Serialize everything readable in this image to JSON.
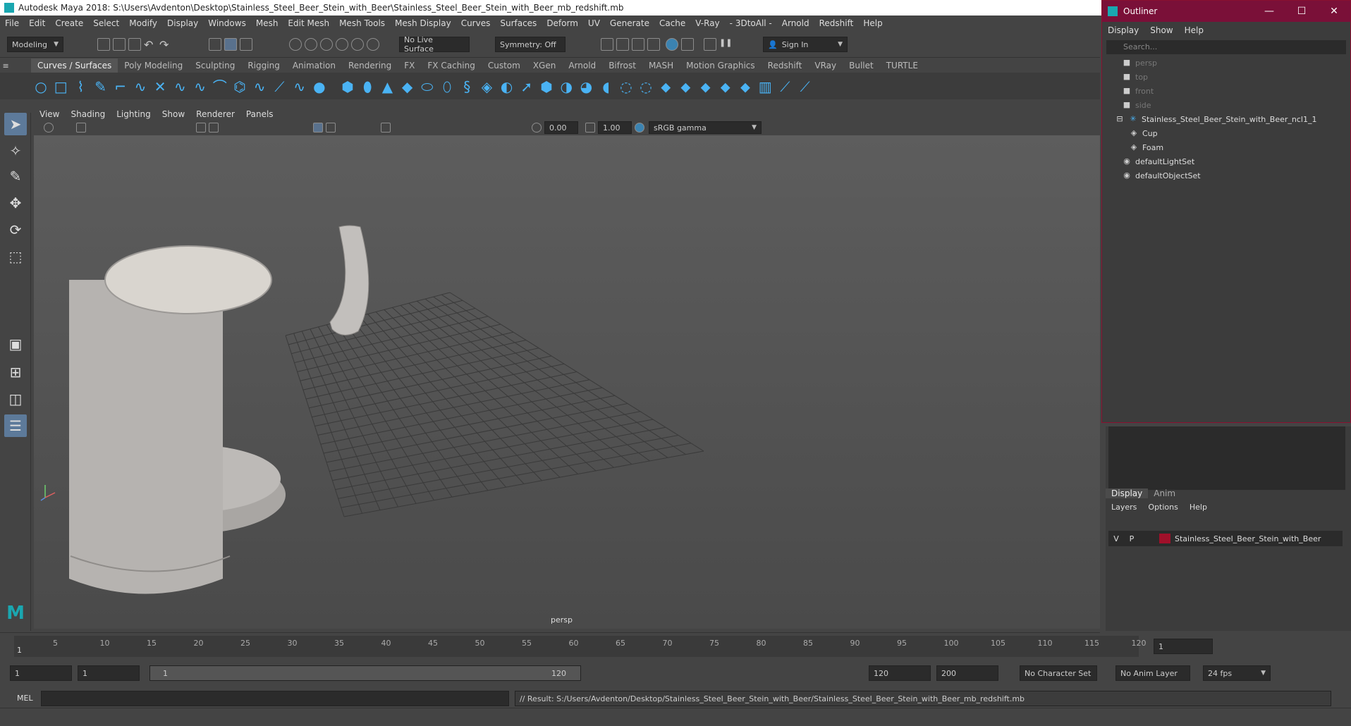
{
  "window": {
    "title": "Autodesk Maya 2018: S:\\Users\\Avdenton\\Desktop\\Stainless_Steel_Beer_Stein_with_Beer\\Stainless_Steel_Beer_Stein_with_Beer_mb_redshift.mb"
  },
  "menubar": [
    "File",
    "Edit",
    "Create",
    "Select",
    "Modify",
    "Display",
    "Windows",
    "Mesh",
    "Edit Mesh",
    "Mesh Tools",
    "Mesh Display",
    "Curves",
    "Surfaces",
    "Deform",
    "UV",
    "Generate",
    "Cache",
    "V-Ray",
    "- 3DtoAll -",
    "Arnold",
    "Redshift",
    "Help"
  ],
  "statusline": {
    "workspace": "Modeling",
    "live_surface": "No Live Surface",
    "symmetry": "Symmetry: Off",
    "sign_in": "Sign In"
  },
  "shelf_tabs": [
    "Curves / Surfaces",
    "Poly Modeling",
    "Sculpting",
    "Rigging",
    "Animation",
    "Rendering",
    "FX",
    "FX Caching",
    "Custom",
    "XGen",
    "Arnold",
    "Bifrost",
    "MASH",
    "Motion Graphics",
    "Redshift",
    "VRay",
    "Bullet",
    "TURTLE"
  ],
  "active_shelf": "Curves / Surfaces",
  "panel_menu": [
    "View",
    "Shading",
    "Lighting",
    "Show",
    "Renderer",
    "Panels"
  ],
  "panel_toolbar": {
    "exposure": "0.00",
    "gamma": "1.00",
    "color_space": "sRGB gamma"
  },
  "viewport": {
    "camera_label": "persp"
  },
  "timeline": {
    "ticks": [
      "5",
      "10",
      "15",
      "20",
      "25",
      "30",
      "35",
      "40",
      "45",
      "50",
      "55",
      "60",
      "65",
      "70",
      "75",
      "80",
      "85",
      "90",
      "95",
      "100",
      "105",
      "110",
      "115",
      "120"
    ],
    "start_marker": "1",
    "current_frame": "1"
  },
  "range": {
    "start": "1",
    "anim_start": "1",
    "slider_start": "1",
    "slider_end": "120",
    "anim_end": "120",
    "end": "200",
    "character_set": "No Character Set",
    "anim_layer": "No Anim Layer",
    "fps": "24 fps"
  },
  "cmdline": {
    "language": "MEL",
    "result": "// Result: S:/Users/Avdenton/Desktop/Stainless_Steel_Beer_Stein_with_Beer/Stainless_Steel_Beer_Stein_with_Beer_mb_redshift.mb"
  },
  "outliner": {
    "title": "Outliner",
    "menu": [
      "Display",
      "Show",
      "Help"
    ],
    "search_placeholder": "Search...",
    "items": [
      {
        "label": "persp",
        "dim": true,
        "icon": "camera-icon",
        "indent": 1
      },
      {
        "label": "top",
        "dim": true,
        "icon": "camera-icon",
        "indent": 1
      },
      {
        "label": "front",
        "dim": true,
        "icon": "camera-icon",
        "indent": 1
      },
      {
        "label": "side",
        "dim": true,
        "icon": "camera-icon",
        "indent": 1
      },
      {
        "label": "Stainless_Steel_Beer_Stein_with_Beer_ncl1_1",
        "dim": false,
        "icon": "group-icon",
        "indent": 0
      },
      {
        "label": "Cup",
        "dim": false,
        "icon": "mesh-icon",
        "indent": 2
      },
      {
        "label": "Foam",
        "dim": false,
        "icon": "mesh-icon",
        "indent": 2
      },
      {
        "label": "defaultLightSet",
        "dim": false,
        "icon": "set-icon",
        "indent": 1
      },
      {
        "label": "defaultObjectSet",
        "dim": false,
        "icon": "set-icon",
        "indent": 1
      }
    ]
  },
  "layers": {
    "tabs": [
      "Display",
      "Anim"
    ],
    "menu": [
      "Layers",
      "Options",
      "Help"
    ],
    "rows": [
      {
        "v": "V",
        "p": "P",
        "name": "Stainless_Steel_Beer_Stein_with_Beer",
        "color": "#a0102a"
      }
    ]
  },
  "colors": {
    "accent": "#4ab3f4",
    "outliner_title": "#7a1038",
    "active_tool": "#5d7a9a"
  }
}
